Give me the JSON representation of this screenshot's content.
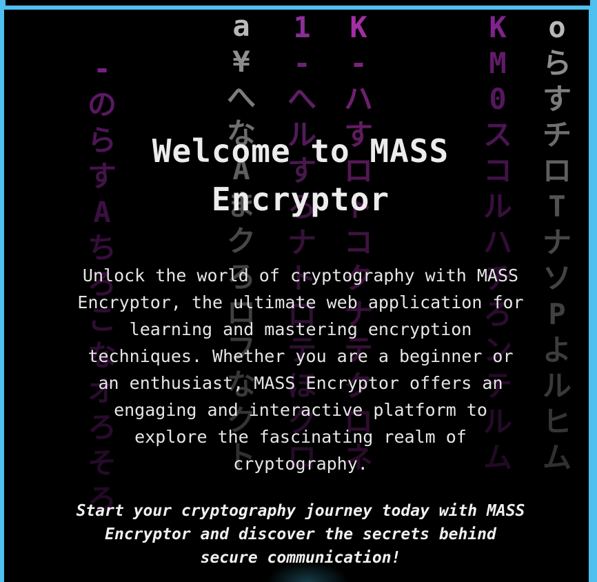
{
  "page": {
    "title_line1": "Welcome to MASS",
    "title_line2": "Encryptor",
    "intro": "Unlock the world of cryptography with MASS Encryptor, the ultimate web application for learning and mastering encryption techniques. Whether you are a beginner or an enthusiast, MASS Encryptor offers an engaging and interactive platform to explore the fascinating realm of cryptography.",
    "cta": "Start your cryptography journey today with MASS Encryptor and discover the secrets behind secure communication!"
  },
  "background": {
    "rain_columns": [
      {
        "glyphs": [
          "-",
          "の",
          "ら",
          "す",
          "A",
          "ち",
          "ろ",
          "こ",
          "な",
          "オ",
          "ろ",
          "そ",
          "ろ"
        ],
        "color": "#b030c0"
      },
      {
        "glyphs": [
          "a",
          "¥",
          "へ",
          "な",
          "A",
          "ま",
          "ク",
          "ろ",
          "ロ",
          "フ",
          "な",
          "ク",
          "ト"
        ],
        "color": "#ffffff"
      },
      {
        "glyphs": [
          "1",
          "-",
          "へ",
          "ル",
          "す",
          "ろ",
          "ナ",
          "ト",
          "ロ",
          "テ",
          "ほ",
          "ク",
          "ロ"
        ],
        "color": "#c040d0"
      },
      {
        "glyphs": [
          "K",
          "-",
          "ハ",
          "す",
          "ロ",
          "ト",
          "コ",
          "ク",
          "ナ",
          "テ",
          "ク",
          "ロ",
          "ネ"
        ],
        "color": "#e040e0"
      },
      {
        "glyphs": [
          "K",
          "M",
          "0",
          "ス",
          "コ",
          "ル",
          "ハ",
          "チ",
          "ろ",
          "ン",
          "テ",
          "ル",
          "ム"
        ],
        "color": "#b030c0"
      },
      {
        "glyphs": [
          "o",
          "ら",
          "す",
          "チ",
          "ロ",
          "T",
          "ナ",
          "ソ",
          "P",
          "よ",
          "ル",
          "ヒ",
          "ム"
        ],
        "color": "#ffffff"
      }
    ]
  }
}
